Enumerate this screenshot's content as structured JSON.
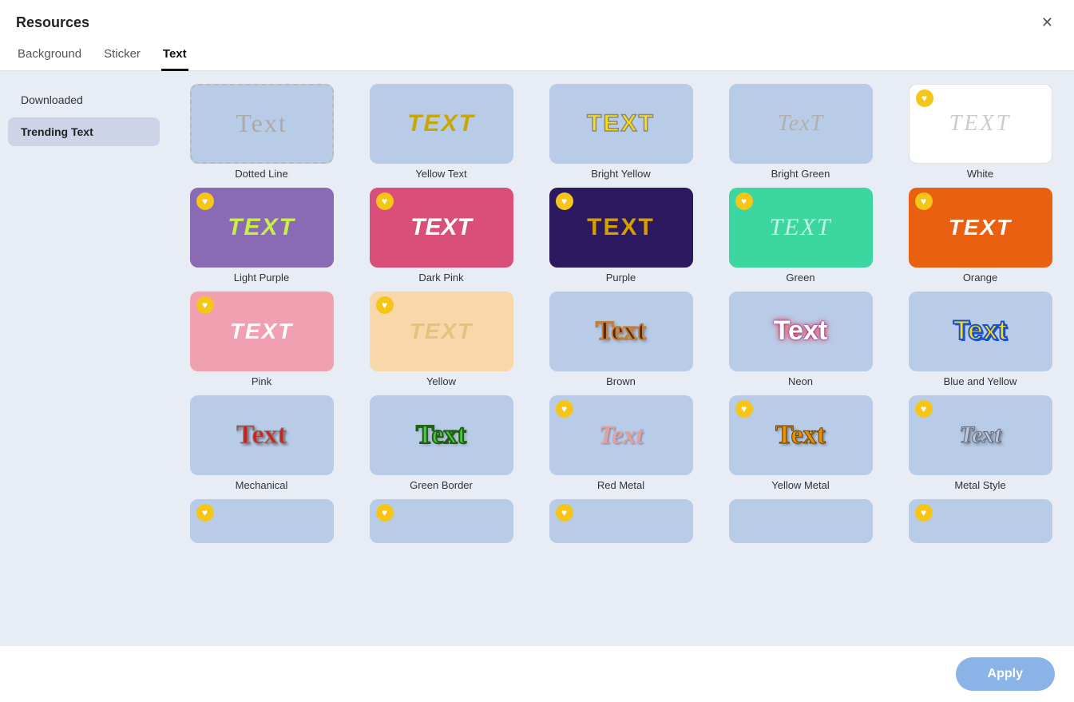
{
  "window": {
    "title": "Resources"
  },
  "tabs": [
    {
      "id": "background",
      "label": "Background",
      "active": false
    },
    {
      "id": "sticker",
      "label": "Sticker",
      "active": false
    },
    {
      "id": "text",
      "label": "Text",
      "active": true
    }
  ],
  "sidebar": {
    "items": [
      {
        "id": "downloaded",
        "label": "Downloaded",
        "active": false
      },
      {
        "id": "trending",
        "label": "Trending Text",
        "active": true
      }
    ]
  },
  "grid": {
    "rows": [
      [
        {
          "id": "dotted-line",
          "label": "Dotted Line",
          "style": "dotted",
          "heart": false
        },
        {
          "id": "yellow-text",
          "label": "Yellow Text",
          "style": "yellow-text",
          "heart": false
        },
        {
          "id": "bright-yellow",
          "label": "Bright Yellow",
          "style": "bright-yellow",
          "heart": false
        },
        {
          "id": "bright-green",
          "label": "Bright Green",
          "style": "bright-green",
          "heart": false
        },
        {
          "id": "white",
          "label": "White",
          "style": "white",
          "heart": true
        }
      ],
      [
        {
          "id": "light-purple",
          "label": "Light Purple",
          "style": "light-purple",
          "heart": true
        },
        {
          "id": "dark-pink",
          "label": "Dark Pink",
          "style": "dark-pink",
          "heart": true
        },
        {
          "id": "purple",
          "label": "Purple",
          "style": "purple",
          "heart": true
        },
        {
          "id": "green",
          "label": "Green",
          "style": "green",
          "heart": true
        },
        {
          "id": "orange",
          "label": "Orange",
          "style": "orange",
          "heart": true
        }
      ],
      [
        {
          "id": "pink",
          "label": "Pink",
          "style": "pink",
          "heart": true
        },
        {
          "id": "yellow",
          "label": "Yellow",
          "style": "yellow",
          "heart": true
        },
        {
          "id": "brown",
          "label": "Brown",
          "style": "brown",
          "heart": false
        },
        {
          "id": "neon",
          "label": "Neon",
          "style": "neon",
          "heart": false
        },
        {
          "id": "blue-yellow",
          "label": "Blue and Yellow",
          "style": "blue-yellow",
          "heart": false
        }
      ],
      [
        {
          "id": "mechanical",
          "label": "Mechanical",
          "style": "mechanical",
          "heart": false
        },
        {
          "id": "green-border",
          "label": "Green Border",
          "style": "green-border",
          "heart": false
        },
        {
          "id": "red-metal",
          "label": "Red Metal",
          "style": "red-metal",
          "heart": true
        },
        {
          "id": "yellow-metal",
          "label": "Yellow Metal",
          "style": "yellow-metal",
          "heart": true
        },
        {
          "id": "metal-style",
          "label": "Metal Style",
          "style": "metal-style",
          "heart": true
        }
      ],
      [
        {
          "id": "partial1",
          "label": "",
          "style": "partial1",
          "heart": true,
          "partial": true
        },
        {
          "id": "partial2",
          "label": "",
          "style": "partial2",
          "heart": true,
          "partial": true
        },
        {
          "id": "partial3",
          "label": "",
          "style": "partial3",
          "heart": true,
          "partial": true
        },
        {
          "id": "partial4",
          "label": "",
          "style": "partial4",
          "heart": false,
          "partial": true
        },
        {
          "id": "partial5",
          "label": "",
          "style": "partial5",
          "heart": true,
          "partial": true
        }
      ]
    ]
  },
  "footer": {
    "apply_label": "Apply"
  },
  "textContent": {
    "TEXT": "TEXT",
    "Text": "Text"
  }
}
